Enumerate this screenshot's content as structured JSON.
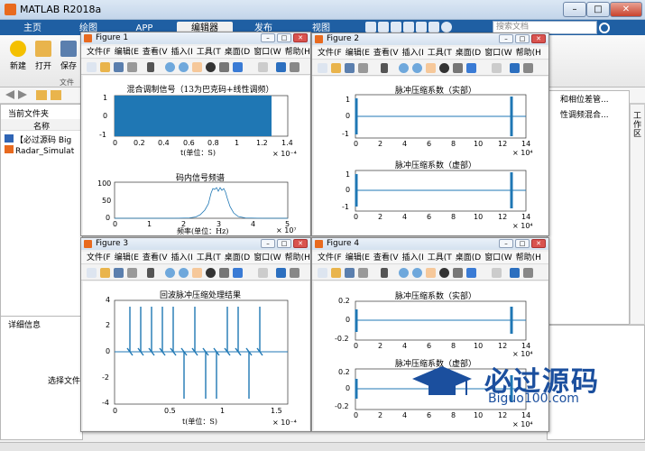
{
  "app": {
    "title": "MATLAB R2018a",
    "win_min": "–",
    "win_max": "□",
    "win_close": "✕"
  },
  "ribbon_tabs": [
    "主页",
    "绘图",
    "APP",
    "编辑器",
    "发布",
    "视图"
  ],
  "active_tab": "编辑器",
  "search": {
    "placeholder": "搜索文档"
  },
  "ribbon_buttons": {
    "new": "新建",
    "open": "打开",
    "save": "保存",
    "group": "文件"
  },
  "left_panel": {
    "header": "当前文件夹",
    "col": "名称",
    "files": [
      "【必过源码 Big",
      "Radar_Simulat"
    ],
    "details": "详细信息",
    "select_hint": "选择文件"
  },
  "editor_right": {
    "line1": "和相位差管...",
    "line2": "性调频混合...",
    "workspace_label": "工作区"
  },
  "figure_menu": [
    "文件(F",
    "编辑(E",
    "查看(V",
    "插入(I",
    "工具(T",
    "桌面(D",
    "窗口(W",
    "帮助(H"
  ],
  "figures": [
    {
      "title": "Figure 1"
    },
    {
      "title": "Figure 2"
    },
    {
      "title": "Figure 3"
    },
    {
      "title": "Figure 4"
    }
  ],
  "fig1": {
    "p1_title": "混合调制信号（13为巴克码+线性调频）",
    "p1_xlabel": "t(单位：S)",
    "p1_xexp": "× 10⁻⁴",
    "p1_xticks": [
      "0",
      "0.2",
      "0.4",
      "0.6",
      "0.8",
      "1",
      "1.2",
      "1.4"
    ],
    "p1_yticks": [
      "1",
      "0",
      "-1"
    ],
    "p2_title": "码内信号频谱",
    "p2_xlabel": "频率(单位：Hz)",
    "p2_xexp": "× 10⁷",
    "p2_xticks": [
      "0",
      "1",
      "2",
      "3",
      "4",
      "5"
    ],
    "p2_yticks": [
      "100",
      "50",
      "0"
    ]
  },
  "fig2": {
    "p1_title": "脉冲压缩系数（实部）",
    "p2_title": "脉冲压缩系数（虚部）",
    "xticks": [
      "0",
      "2",
      "4",
      "6",
      "8",
      "10",
      "12",
      "14"
    ],
    "xexp": "× 10⁴",
    "yticks": [
      "1",
      "0",
      "-1"
    ]
  },
  "fig3": {
    "title": "回波脉冲压缩处理结果",
    "xlabel": "t(单位：S)",
    "xexp": "× 10⁻⁴",
    "xticks": [
      "0",
      "0.5",
      "1",
      "1.5"
    ],
    "yticks": [
      "4",
      "2",
      "0",
      "-2",
      "-4"
    ]
  },
  "fig4": {
    "p1_title": "脉冲压缩系数（实部）",
    "p1_yticks": [
      "0.2",
      "0",
      "-0.2"
    ],
    "p2_title": "脉冲压缩系数（虚部）",
    "p2_yticks": [
      "0.2",
      "0",
      "-0.2"
    ],
    "xticks": [
      "0",
      "2",
      "4",
      "6",
      "8",
      "10",
      "12",
      "14"
    ],
    "xexp": "× 10⁴"
  },
  "watermark": {
    "big": "必过源码",
    "small": "Biguo100.com"
  },
  "colors": {
    "ribbon_blue": "#1f5fa3",
    "plot_blue": "#1f77b4",
    "logo_orange": "#e86a1f"
  }
}
